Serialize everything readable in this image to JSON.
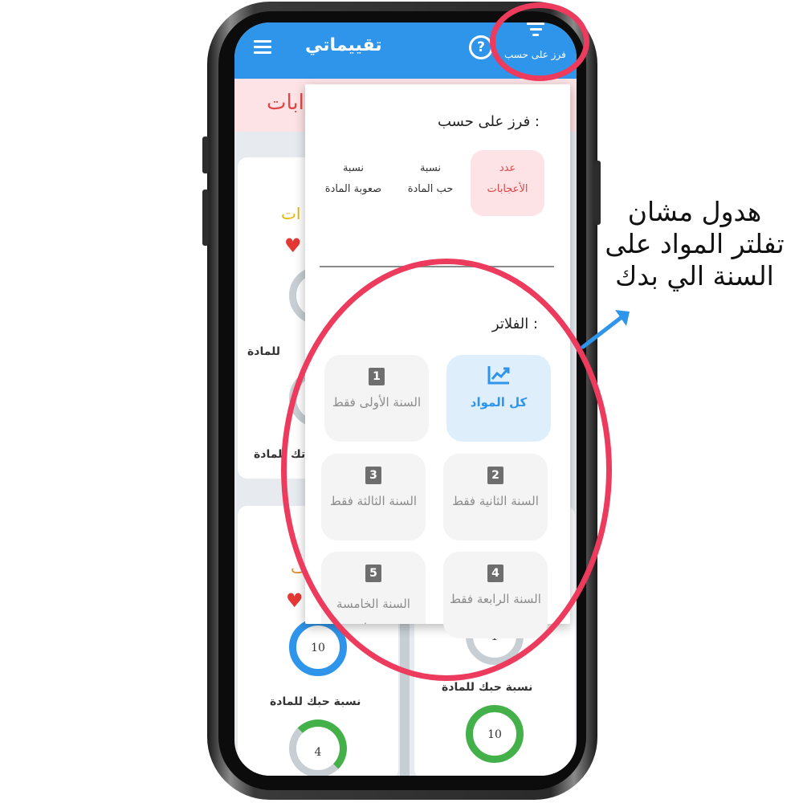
{
  "app_bar": {
    "title": "تقييماتي",
    "help": "?",
    "sort_label": "فرز على حسب",
    "menu_icon": "menu-icon",
    "sort_icon": "filter-sort-icon"
  },
  "background": {
    "banner_text": "ابات",
    "card_partial_gold": "ات",
    "label_subject_partial": "للمادة",
    "label_love_partial": "تك للمادة",
    "label_love_left": "نسبة حبك للمادة",
    "label_love_right": "نسبة حبك للمادة",
    "ring_values": [
      "10",
      "1",
      "10",
      "4"
    ]
  },
  "popup": {
    "sort_title": "فرز على حسب :",
    "sort_options": [
      {
        "line1": "عدد",
        "line2": "الأعجابات",
        "active": true
      },
      {
        "line1": "نسبة",
        "line2": "حب المادة",
        "active": false
      },
      {
        "line1": "نسبة",
        "line2": "صعوبة المادة",
        "active": false
      }
    ],
    "filters_title": "الفلاتر :",
    "filters": [
      {
        "badge": "",
        "label": "كل المواد",
        "icon": "trending-chart-icon",
        "active": true
      },
      {
        "badge": "1",
        "label": "السنة الأولى فقط",
        "active": false
      },
      {
        "badge": "2",
        "label": "السنة الثانية فقط",
        "active": false
      },
      {
        "badge": "3",
        "label": "السنة الثالثة فقط",
        "active": false
      },
      {
        "badge": "4",
        "label": "السنة الرابعة فقط",
        "active": false
      },
      {
        "badge": "5",
        "label": "السنة الخامسة فقط",
        "active": false
      }
    ]
  },
  "annotation": {
    "lines": [
      "هدول مشان",
      "تفلتر المواد على",
      "السنة الي بدك"
    ],
    "color": "#ec3b5c",
    "arrow_color": "#2f95ea"
  },
  "colors": {
    "app_bar": "#2f95ea",
    "accent_red": "#e04747",
    "active_tile": "#deeefb"
  }
}
